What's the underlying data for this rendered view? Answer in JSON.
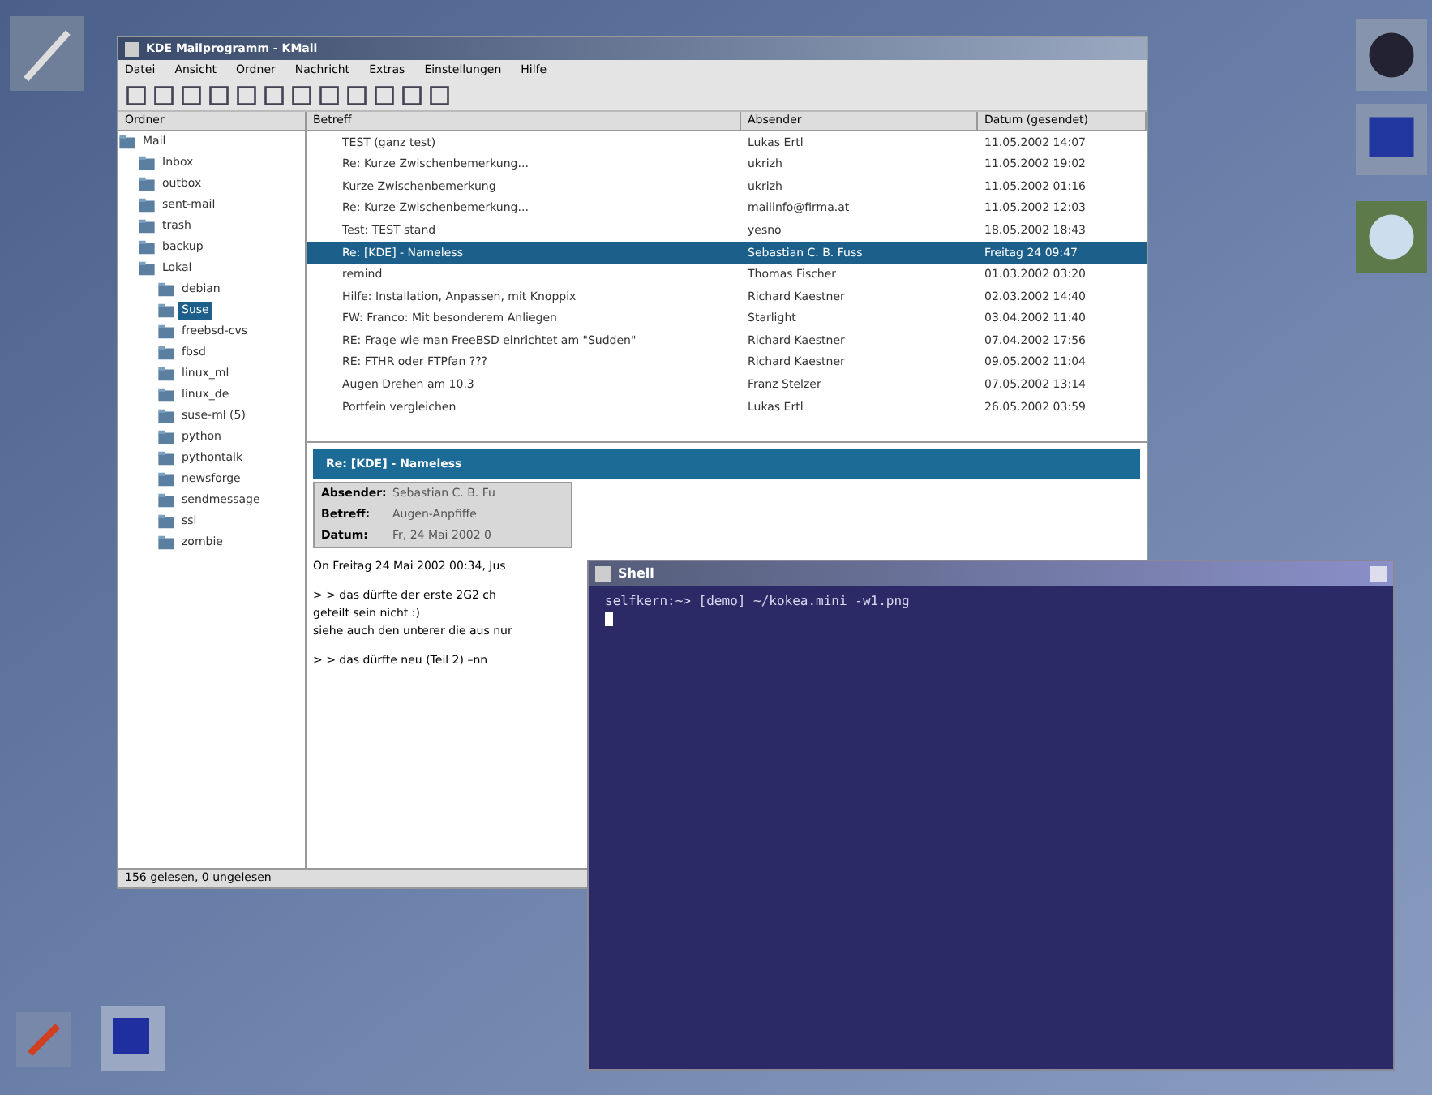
{
  "mail_window": {
    "title": "KDE Mailprogramm - KMail",
    "menu": [
      "Datei",
      "Ansicht",
      "Ordner",
      "Nachricht",
      "Extras",
      "Einstellungen",
      "Hilfe"
    ],
    "folder_column": "Ordner",
    "folders": [
      {
        "label": "Mail",
        "selected": false,
        "children": [
          {
            "label": "Inbox",
            "selected": false
          },
          {
            "label": "outbox",
            "selected": false
          },
          {
            "label": "sent-mail",
            "selected": false
          },
          {
            "label": "trash",
            "selected": false
          },
          {
            "label": "backup",
            "selected": false
          },
          {
            "label": "Lokal",
            "selected": false,
            "children": [
              {
                "label": "debian",
                "selected": false
              },
              {
                "label": "Suse",
                "selected": true
              },
              {
                "label": "freebsd-cvs",
                "selected": false
              },
              {
                "label": "fbsd",
                "selected": false
              },
              {
                "label": "linux_ml",
                "selected": false
              },
              {
                "label": "linux_de",
                "selected": false
              },
              {
                "label": "suse-ml (5)",
                "selected": false
              },
              {
                "label": "python",
                "selected": false
              },
              {
                "label": "pythontalk",
                "selected": false
              },
              {
                "label": "newsforge",
                "selected": false
              },
              {
                "label": "sendmessage",
                "selected": false
              },
              {
                "label": "ssl",
                "selected": false
              },
              {
                "label": "zombie",
                "selected": false
              }
            ]
          }
        ]
      }
    ],
    "columns": [
      "Betreff",
      "Absender",
      "Datum (gesendet)"
    ],
    "messages": [
      {
        "subject": "TEST (ganz test)",
        "sender": "Lukas Ertl",
        "date": "11.05.2002 14:07",
        "selected": false
      },
      {
        "subject": "Re: Kurze Zwischenbemerkung...",
        "sender": "ukrizh",
        "date": "11.05.2002 19:02",
        "selected": false
      },
      {
        "subject": "Kurze Zwischenbemerkung",
        "sender": "ukrizh",
        "date": "11.05.2002 01:16",
        "selected": false
      },
      {
        "subject": "Re: Kurze Zwischenbemerkung...",
        "sender": "mailinfo@firma.at",
        "date": "11.05.2002 12:03",
        "selected": false
      },
      {
        "subject": "Test: TEST stand",
        "sender": "yesno",
        "date": "18.05.2002 18:43",
        "selected": false
      },
      {
        "subject": "Re: [KDE] - Nameless",
        "sender": "Sebastian C. B. Fuss",
        "date": "Freitag 24 09:47",
        "selected": true
      },
      {
        "subject": "remind",
        "sender": "Thomas Fischer",
        "date": "01.03.2002 03:20",
        "selected": false
      },
      {
        "subject": "Hilfe: Installation, Anpassen, mit Knoppix",
        "sender": "Richard Kaestner",
        "date": "02.03.2002 14:40",
        "selected": false
      },
      {
        "subject": "FW: Franco: Mit besonderem Anliegen",
        "sender": "Starlight",
        "date": "03.04.2002 11:40",
        "selected": false
      },
      {
        "subject": "RE: Frage wie man FreeBSD einrichtet am \"Sudden\"",
        "sender": "Richard Kaestner",
        "date": "07.04.2002 17:56",
        "selected": false
      },
      {
        "subject": "RE: FTHR oder FTPfan ???",
        "sender": "Richard Kaestner",
        "date": "09.05.2002 11:04",
        "selected": false
      },
      {
        "subject": "Augen Drehen am 10.3",
        "sender": "Franz Stelzer",
        "date": "07.05.2002 13:14",
        "selected": false
      },
      {
        "subject": "Portfein vergleichen",
        "sender": "Lukas Ertl",
        "date": "26.05.2002 03:59",
        "selected": false
      }
    ],
    "preview": {
      "title": "Re: [KDE] - Nameless",
      "fields": [
        {
          "label": "Absender:",
          "value": "Sebastian C. B. Fu"
        },
        {
          "label": "Betreff:",
          "value": "Augen-Anpfiffe"
        },
        {
          "label": "Datum:",
          "value": "Fr, 24 Mai 2002 0"
        }
      ],
      "body": [
        [
          "On Freitag 24 Mai 2002 00:34, Jus"
        ],
        [
          "> > das dürfte der erste 2G2 ch",
          "geteilt sein nicht :)",
          "siehe auch den unterer die aus nur"
        ],
        [
          "> > das dürfte neu (Teil 2) –nn"
        ]
      ]
    },
    "status_bar": "156 gelesen, 0 ungelesen"
  },
  "terminal": {
    "title": "Shell",
    "lines": [
      "selfkern:~> [demo] ~/kokea.mini -w1.png"
    ]
  }
}
